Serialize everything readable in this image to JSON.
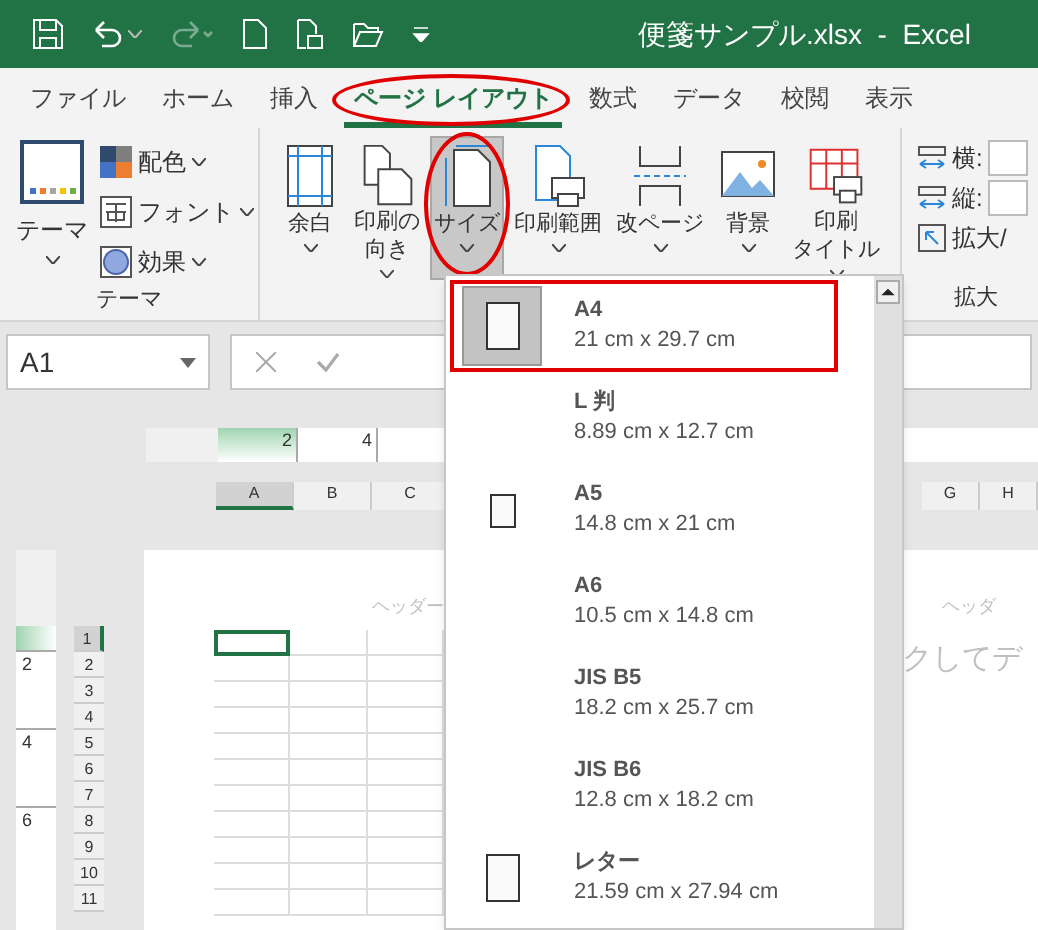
{
  "title_bar": {
    "title": "便箋サンプル.xlsx  -  Excel"
  },
  "tabs": [
    {
      "label": "ファイル",
      "selected": false,
      "highlighted": false
    },
    {
      "label": "ホーム",
      "selected": false,
      "highlighted": false
    },
    {
      "label": "挿入",
      "selected": false,
      "highlighted": false
    },
    {
      "label": "ページ レイアウト",
      "selected": true,
      "highlighted": true
    },
    {
      "label": "数式",
      "selected": false,
      "highlighted": false
    },
    {
      "label": "データ",
      "selected": false,
      "highlighted": false
    },
    {
      "label": "校閲",
      "selected": false,
      "highlighted": false
    },
    {
      "label": "表示",
      "selected": false,
      "highlighted": false
    }
  ],
  "theme_group": {
    "label": "テーマ",
    "big_button": {
      "label": "テーマ"
    },
    "small_buttons": [
      {
        "label": "配色",
        "kind": "colors"
      },
      {
        "label": "フォント",
        "kind": "fonts"
      },
      {
        "label": "効果",
        "kind": "effects"
      }
    ]
  },
  "page_setup_group": {
    "buttons": [
      {
        "lines": [
          "余白"
        ],
        "kind": "margins",
        "pressed": false,
        "highlighted": false
      },
      {
        "lines": [
          "印刷の",
          "向き"
        ],
        "kind": "orientation",
        "pressed": false,
        "highlighted": false
      },
      {
        "lines": [
          "サイズ"
        ],
        "kind": "size",
        "pressed": true,
        "highlighted": true
      },
      {
        "lines": [
          "印刷範囲"
        ],
        "kind": "print_area",
        "pressed": false,
        "highlighted": false
      },
      {
        "lines": [
          "改ページ"
        ],
        "kind": "breaks",
        "pressed": false,
        "highlighted": false
      },
      {
        "lines": [
          "背景"
        ],
        "kind": "background",
        "pressed": false,
        "highlighted": false
      },
      {
        "lines": [
          "印刷",
          "タイトル"
        ],
        "kind": "print_titles",
        "pressed": false,
        "highlighted": false
      }
    ]
  },
  "scale_group": {
    "label": "拡大",
    "fields": [
      {
        "label": "横:"
      },
      {
        "label": "縦:"
      }
    ],
    "button": {
      "label": "拡大/"
    }
  },
  "name_box": {
    "value": "A1"
  },
  "ruler": {
    "ticks": [
      "2",
      "4"
    ],
    "vertical_ticks": [
      "2",
      "4",
      "6"
    ]
  },
  "columns": [
    {
      "label": "A",
      "selected": true
    },
    {
      "label": "B",
      "selected": false
    },
    {
      "label": "C",
      "selected": false
    }
  ],
  "columns_right": [
    {
      "label": "G",
      "selected": false
    },
    {
      "label": "H",
      "selected": false
    }
  ],
  "rows": [
    {
      "label": "1",
      "selected": true
    },
    {
      "label": "2",
      "selected": false
    },
    {
      "label": "3",
      "selected": false
    },
    {
      "label": "4",
      "selected": false
    },
    {
      "label": "5",
      "selected": false
    },
    {
      "label": "6",
      "selected": false
    },
    {
      "label": "7",
      "selected": false
    },
    {
      "label": "8",
      "selected": false
    },
    {
      "label": "9",
      "selected": false
    },
    {
      "label": "10",
      "selected": false
    },
    {
      "label": "11",
      "selected": false
    }
  ],
  "page": {
    "header_left": "ヘッダー",
    "header_right": "ヘッダ",
    "placeholder_right": "クしてデ"
  },
  "size_menu": {
    "items": [
      {
        "name": "A4",
        "dims": "21 cm x 29.7 cm",
        "selected": true,
        "highlighted": true,
        "kind": "large"
      },
      {
        "name": "L 判",
        "dims": "8.89 cm x 12.7 cm",
        "selected": false,
        "highlighted": false,
        "kind": "plain"
      },
      {
        "name": "A5",
        "dims": "14.8 cm x 21 cm",
        "selected": false,
        "highlighted": false,
        "kind": "small"
      },
      {
        "name": "A6",
        "dims": "10.5 cm x 14.8 cm",
        "selected": false,
        "highlighted": false,
        "kind": "plain"
      },
      {
        "name": "JIS B5",
        "dims": "18.2 cm x 25.7 cm",
        "selected": false,
        "highlighted": false,
        "kind": "plain"
      },
      {
        "name": "JIS B6",
        "dims": "12.8 cm x 18.2 cm",
        "selected": false,
        "highlighted": false,
        "kind": "plain"
      },
      {
        "name": "レター",
        "dims": "21.59 cm x 27.94 cm",
        "selected": false,
        "highlighted": false,
        "kind": "large"
      }
    ]
  }
}
